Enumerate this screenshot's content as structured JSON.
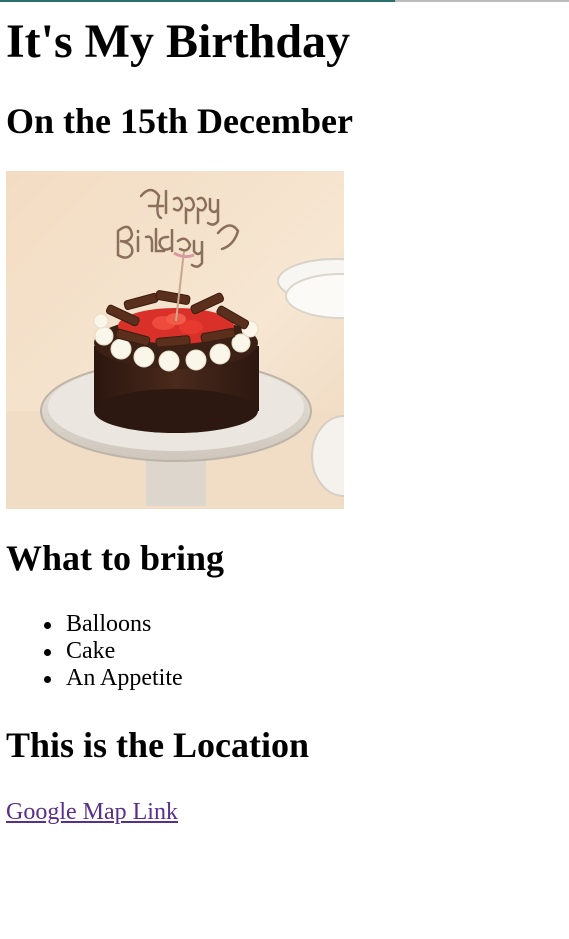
{
  "page": {
    "title": "It's My Birthday",
    "subtitle": "On the 15th December"
  },
  "image": {
    "alt": "Birthday cake",
    "icon": "birthday-cake-photo",
    "topper_text": "Happy Birthday"
  },
  "bring": {
    "heading": "What to bring",
    "items": [
      "Balloons",
      "Cake",
      "An Appetite"
    ]
  },
  "location": {
    "heading": "This is the Location",
    "link_text": "Google Map Link"
  },
  "colors": {
    "link_visited": "#5a2e8c",
    "text": "#000000",
    "background": "#ffffff"
  }
}
